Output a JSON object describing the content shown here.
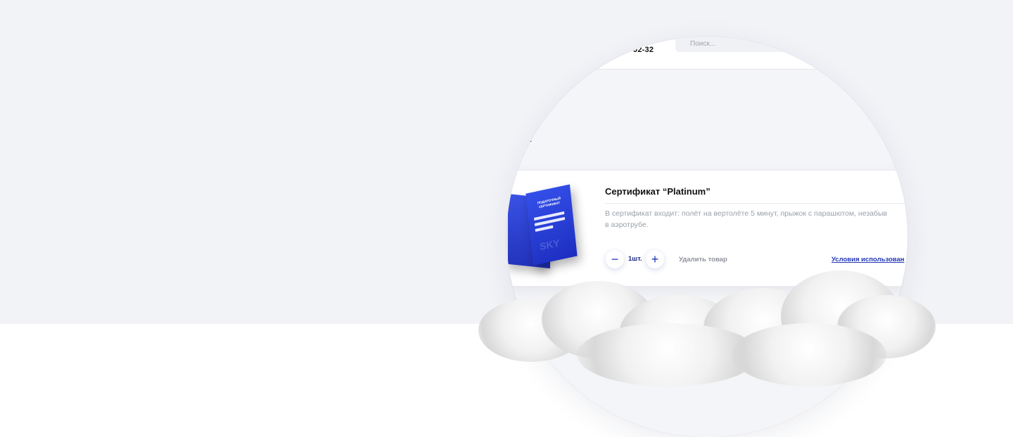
{
  "header": {
    "phone_fragment": "92-32",
    "search_placeholder": "Поиск..."
  },
  "page": {
    "title_fragment": "а:"
  },
  "product": {
    "title": "Сертификат “Platinum”",
    "description_line1": "В сертификат входит: полёт на вертолёте 5 минут, прыжок с парашютом, незабыв",
    "description_line2": "в аэротрубе.",
    "quantity": "1шт.",
    "minus_label": "−",
    "plus_label": "+",
    "remove_label": "Удалить товар",
    "terms_label": "Условия использован",
    "booklet": {
      "title_line1": "ПОДАРОЧНЫЙ",
      "title_line2": "СЕРТИФИКАТ",
      "brand": "SKY"
    }
  },
  "colors": {
    "accent": "#2438b6",
    "background": "#f2f3f7"
  },
  "icons": [
    "minus-icon",
    "plus-icon",
    "cloud-decoration"
  ]
}
